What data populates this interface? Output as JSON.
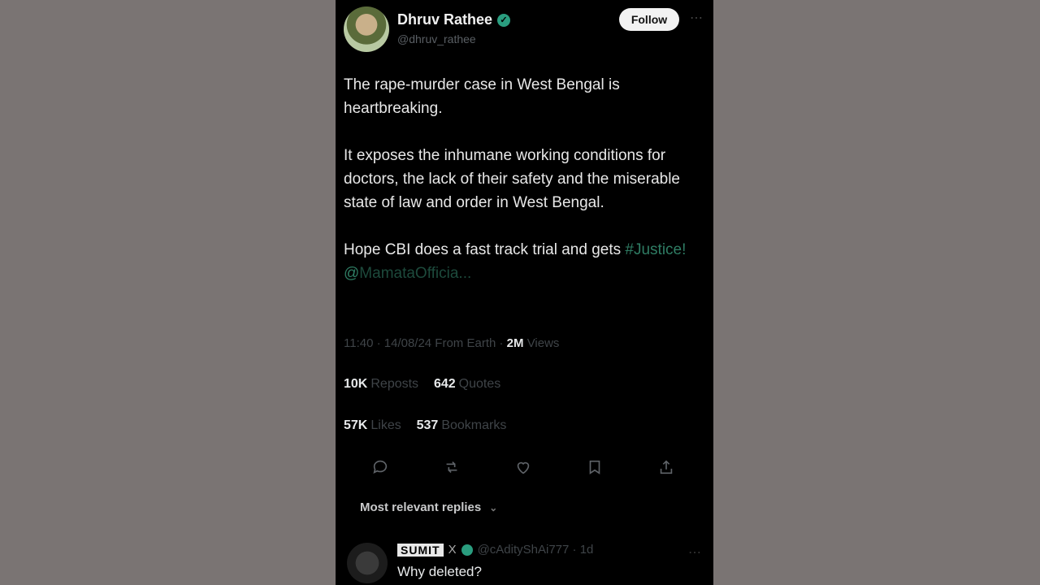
{
  "tweet": {
    "author_name": "Dhruv Rathee",
    "author_handle": "@dhruv_rathee",
    "follow_label": "Follow",
    "paragraph1": "The rape-murder case in West Bengal is heartbreaking.",
    "paragraph2": "It exposes the inhumane working conditions for doctors, the lack of their safety and the miserable state of law and order in West Bengal.",
    "paragraph3_text": "Hope CBI does a fast track trial and gets ",
    "hashtag": "#Justice!",
    "mention": "@",
    "mention_truncated": "MamataOfficia...",
    "timestamp": "11:40 · 14/08/24 From Earth ·",
    "views_count": "2M",
    "views_label": "Views",
    "reposts_count": "10K",
    "reposts_label": "Reposts",
    "quotes_count": "642",
    "quotes_label": "Quotes",
    "likes_count": "57K",
    "likes_label": "Likes",
    "bookmarks_count": "537",
    "bookmarks_label": "Bookmarks"
  },
  "actions": [
    "reply-icon",
    "repost-icon",
    "like-icon",
    "bookmark-icon",
    "share-icon"
  ],
  "replies": {
    "sort_label": "Most relevant replies",
    "first": {
      "name": "SUMIT",
      "x_mark": "X",
      "handle": "@cAdityShAi777 · 1d",
      "text": "Why deleted?"
    }
  },
  "colors": {
    "background": "#7a7473",
    "phone": "#000000",
    "accent": "#2a9d7f"
  }
}
